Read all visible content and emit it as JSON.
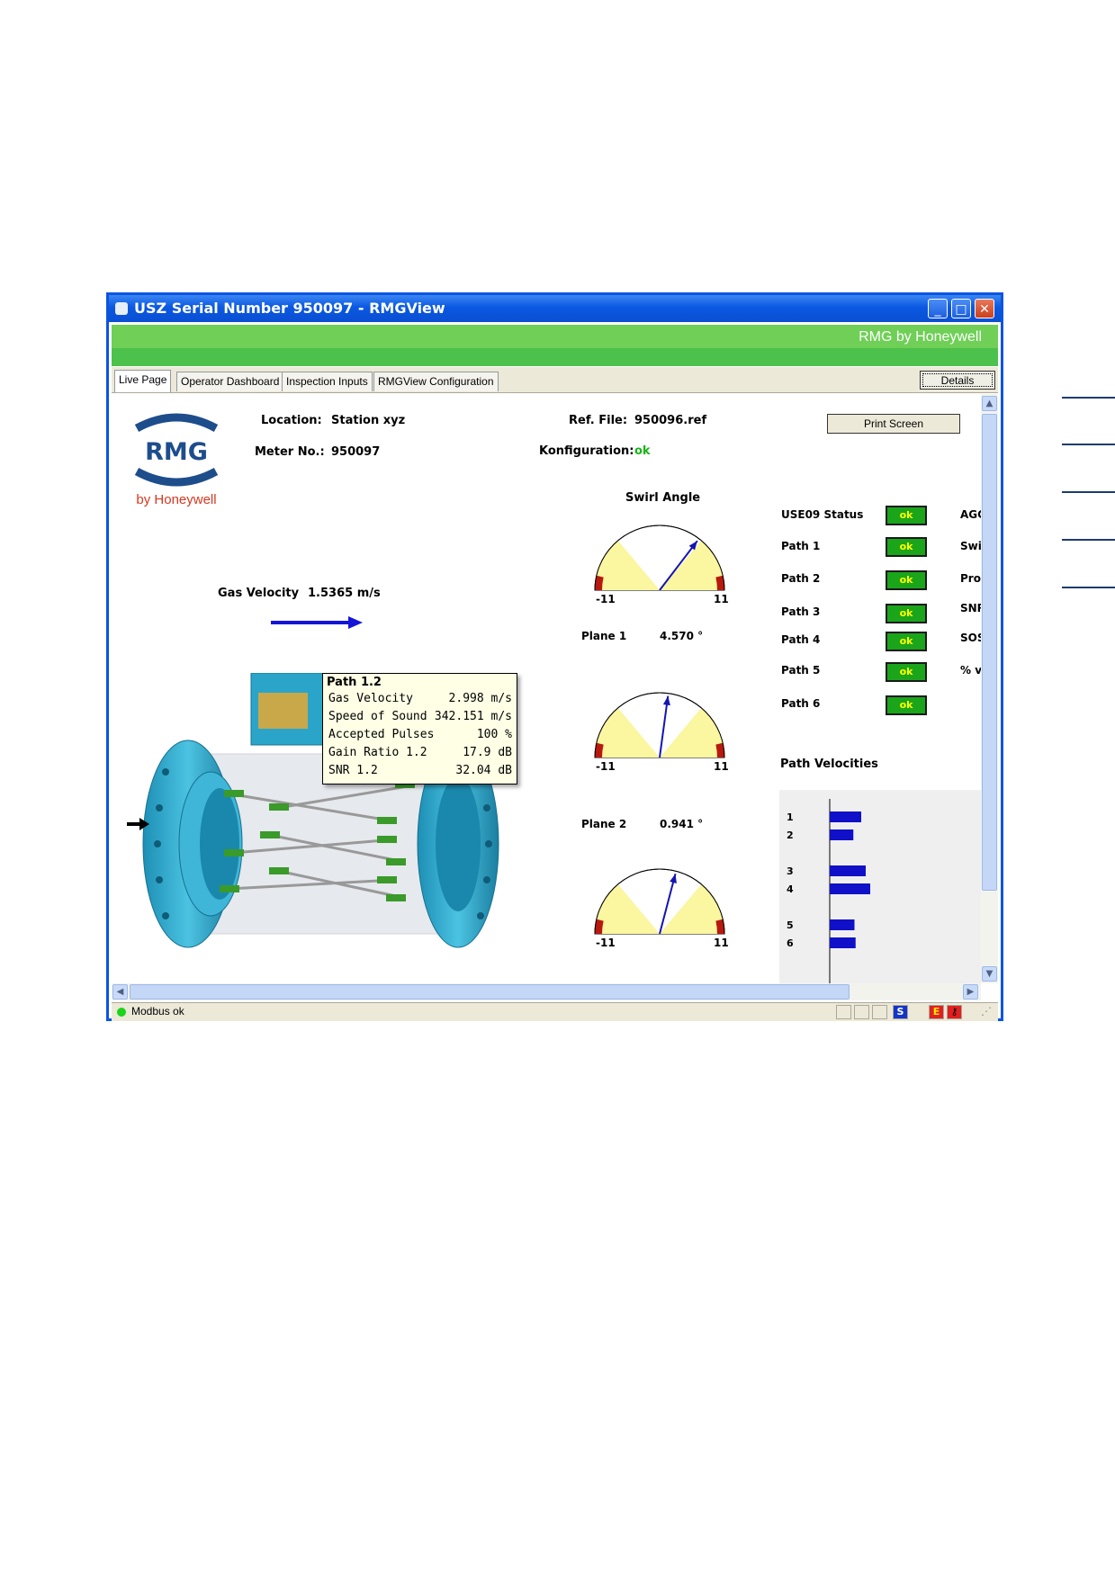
{
  "window": {
    "title": "USZ Serial Number 950097 - RMGView",
    "brand": "RMG by Honeywell",
    "controls": {
      "minimize": "_",
      "maximize": "□",
      "close": "✕"
    }
  },
  "tabs": [
    {
      "label": "Live Page",
      "active": true
    },
    {
      "label": "Operator Dashboard",
      "active": false
    },
    {
      "label": "Inspection Inputs",
      "active": false
    },
    {
      "label": "RMGView Configuration",
      "active": false
    }
  ],
  "details_label": "Details",
  "logo": {
    "text": "RMG",
    "sub": "by Honeywell"
  },
  "info": {
    "location_label": "Location:",
    "location_value": "Station xyz",
    "meter_label": "Meter No.:",
    "meter_value": "950097",
    "ref_label": "Ref. File:",
    "ref_value": "950096.ref",
    "konfig_label": "Konfiguration:",
    "konfig_value": "ok"
  },
  "print_label": "Print Screen",
  "gas_velocity": {
    "label": "Gas Velocity",
    "value": "1.5365 m/s"
  },
  "swirl": {
    "title": "Swirl Angle",
    "min_label": "-11",
    "max_label": "11",
    "gauges": [
      {
        "plane_label": "Plane 1",
        "value_text": "4.570 °",
        "angle": 4.57
      },
      {
        "plane_label": "Plane 2",
        "value_text": "0.941 °",
        "angle": 0.941
      },
      {
        "plane_label": "",
        "value_text": "",
        "angle": 1.8
      }
    ]
  },
  "status": {
    "rows": [
      {
        "label": "USE09 Status",
        "value": "ok"
      },
      {
        "label": "Path 1",
        "value": "ok"
      },
      {
        "label": "Path 2",
        "value": "ok"
      },
      {
        "label": "Path 3",
        "value": "ok"
      },
      {
        "label": "Path 4",
        "value": "ok"
      },
      {
        "label": "Path 5",
        "value": "ok"
      },
      {
        "label": "Path 6",
        "value": "ok"
      }
    ],
    "right_labels": [
      "AGC",
      "Swi",
      "Pro",
      "SNR",
      "SOS",
      "% v"
    ]
  },
  "path_velocities": {
    "title": "Path Velocities",
    "labels": [
      "1",
      "2",
      "3",
      "4",
      "5",
      "6"
    ]
  },
  "chart_data": {
    "type": "bar",
    "title": "Path Velocities",
    "categories": [
      "1",
      "2",
      "3",
      "4",
      "5",
      "6"
    ],
    "values": [
      1.4,
      1.05,
      1.6,
      1.8,
      1.1,
      1.15
    ]
  },
  "tooltip": {
    "title": "Path 1.2",
    "rows": [
      {
        "k": "Gas Velocity",
        "v": "2.998 m/s"
      },
      {
        "k": "Speed of Sound",
        "v": "342.151 m/s"
      },
      {
        "k": "Accepted Pulses",
        "v": "100 %"
      },
      {
        "k": "Gain Ratio 1.2",
        "v": "17.9 dB"
      },
      {
        "k": "SNR 1.2",
        "v": "32.04 dB"
      }
    ]
  },
  "statusbar": {
    "text": "Modbus ok",
    "boxes": [
      "S",
      "E"
    ]
  },
  "colors": {
    "window_blue": "#0a55e0",
    "green_bar": "#4cc14c",
    "ok_green": "#1aa51a",
    "ok_text": "#ffff00",
    "bar_blue": "#1010c8",
    "meter_blue": "#2aa5c9"
  }
}
